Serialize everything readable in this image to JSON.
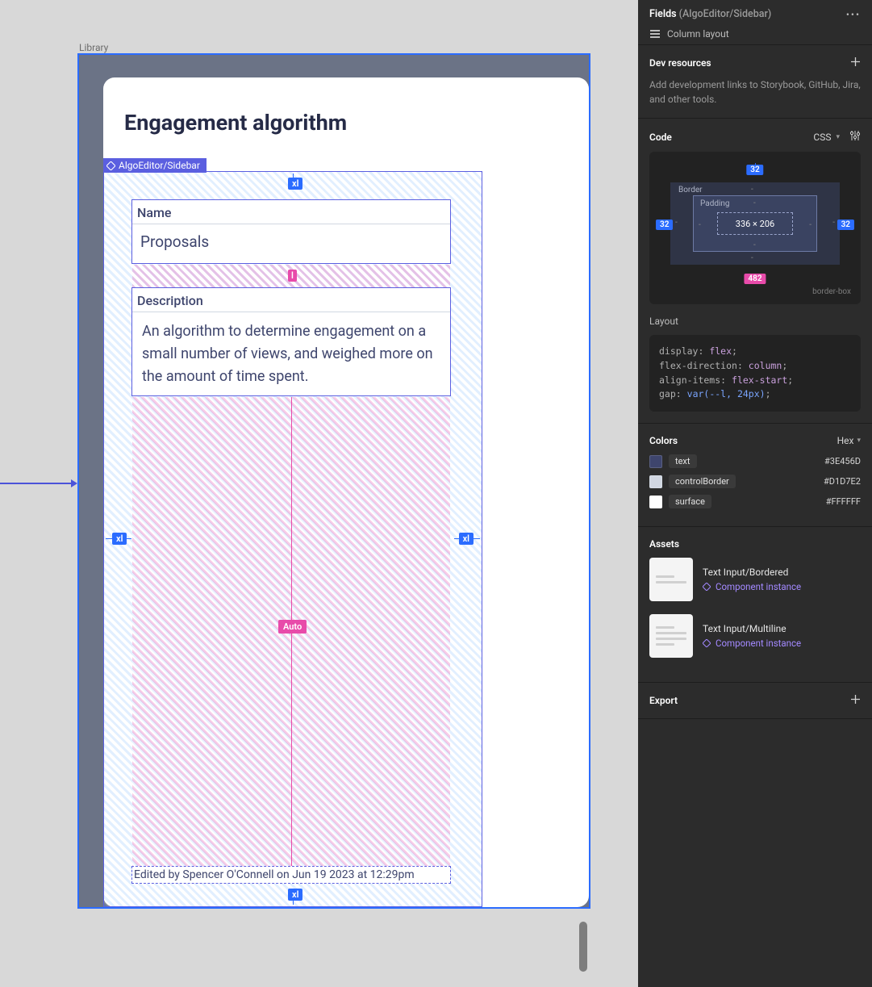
{
  "canvas": {
    "libraryLabel": "Library",
    "cardTitle": "Engagement algorithm",
    "selectionTag": "AlgoEditor/Sidebar",
    "fields": {
      "nameLabel": "Name",
      "nameValue": "Proposals",
      "descLabel": "Description",
      "descValue": "An algorithm to determine engagement on a small number of views, and weighed more on the amount of time spent."
    },
    "footer": "Edited by Spencer O'Connell on Jun 19 2023 at 12:29pm",
    "paddingBadges": {
      "top": "xl",
      "bottom": "xl",
      "left": "xl",
      "right": "xl"
    },
    "gapBadges": {
      "between": "l",
      "auto": "Auto"
    }
  },
  "panel": {
    "titlePrefix": "Fields",
    "titleSuffix": "(AlgoEditor/Sidebar)",
    "layoutMode": "Column layout",
    "devResources": {
      "heading": "Dev resources",
      "hint": "Add development links to Storybook, GitHub, Jira, and other tools."
    },
    "code": {
      "heading": "Code",
      "lang": "CSS",
      "boxModel": {
        "borderLabel": "Border",
        "paddingLabel": "Padding",
        "contentSize": "336 × 206",
        "marginTop": "32",
        "marginLeft": "32",
        "marginRight": "32",
        "marginBottom": "482",
        "boxSizing": "border-box"
      },
      "layoutLabel": "Layout",
      "css": {
        "display": "flex",
        "flexDirection": "column",
        "alignItems": "flex-start",
        "gapRaw": "var(--l, 24px)"
      }
    },
    "colors": {
      "heading": "Colors",
      "format": "Hex",
      "items": [
        {
          "name": "text",
          "hex": "#3E456D"
        },
        {
          "name": "controlBorder",
          "hex": "#D1D7E2"
        },
        {
          "name": "surface",
          "hex": "#FFFFFF"
        }
      ]
    },
    "assets": {
      "heading": "Assets",
      "instanceLabel": "Component instance",
      "items": [
        {
          "name": "Text Input/Bordered"
        },
        {
          "name": "Text Input/Multiline"
        }
      ]
    },
    "export": {
      "heading": "Export"
    }
  }
}
